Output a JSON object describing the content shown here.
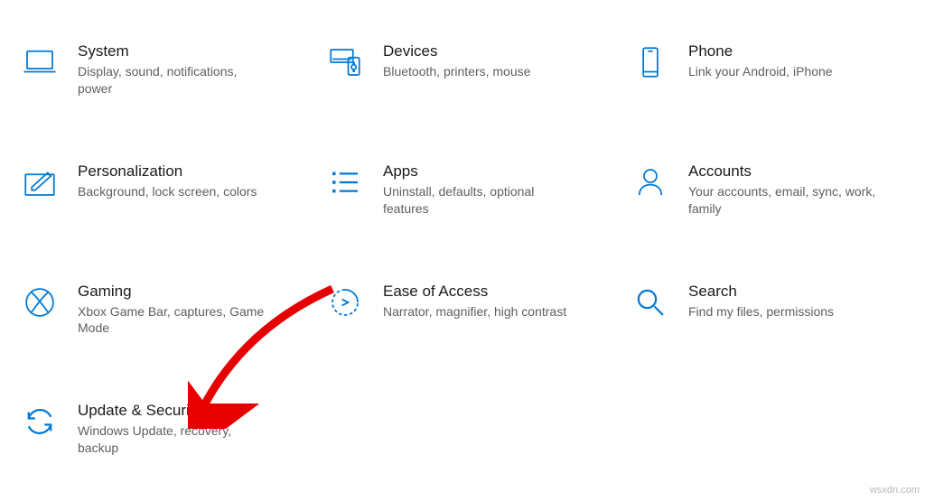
{
  "accent": "#0078d4",
  "tiles": [
    {
      "id": "system",
      "icon": "laptop-icon",
      "title": "System",
      "desc": "Display, sound, notifications, power"
    },
    {
      "id": "devices",
      "icon": "devices-icon",
      "title": "Devices",
      "desc": "Bluetooth, printers, mouse"
    },
    {
      "id": "phone",
      "icon": "phone-icon",
      "title": "Phone",
      "desc": "Link your Android, iPhone"
    },
    {
      "id": "personalization",
      "icon": "pen-icon",
      "title": "Personalization",
      "desc": "Background, lock screen, colors"
    },
    {
      "id": "apps",
      "icon": "list-icon",
      "title": "Apps",
      "desc": "Uninstall, defaults, optional features"
    },
    {
      "id": "accounts",
      "icon": "person-icon",
      "title": "Accounts",
      "desc": "Your accounts, email, sync, work, family"
    },
    {
      "id": "gaming",
      "icon": "xbox-icon",
      "title": "Gaming",
      "desc": "Xbox Game Bar, captures, Game Mode"
    },
    {
      "id": "ease-of-access",
      "icon": "ease-icon",
      "title": "Ease of Access",
      "desc": "Narrator, magnifier, high contrast"
    },
    {
      "id": "search",
      "icon": "search-icon",
      "title": "Search",
      "desc": "Find my files, permissions"
    },
    {
      "id": "update-security",
      "icon": "sync-icon",
      "title": "Update & Security",
      "desc": "Windows Update, recovery, backup"
    }
  ],
  "watermark": "wsxdn.com"
}
